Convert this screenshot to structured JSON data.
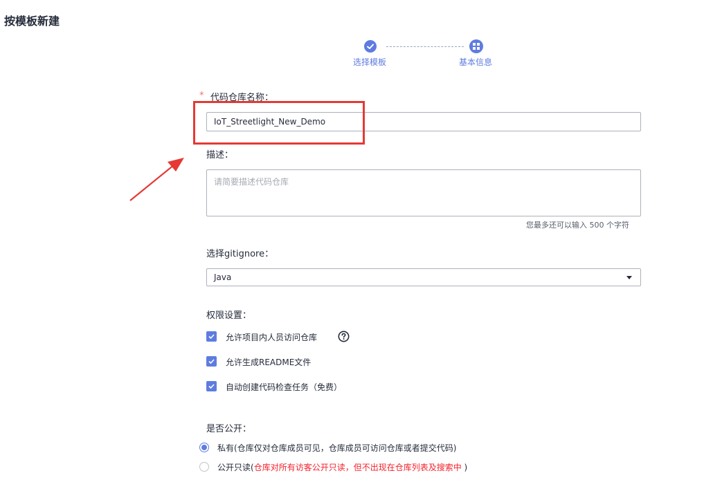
{
  "page": {
    "title": "按模板新建"
  },
  "stepper": {
    "steps": [
      {
        "label": "选择模板",
        "state": "done"
      },
      {
        "label": "基本信息",
        "state": "active"
      }
    ],
    "accent": "#5e7ce0"
  },
  "form": {
    "name": {
      "required_mark": "*",
      "label": "代码仓库名称：",
      "value": "IoT_Streetlight_New_Demo"
    },
    "description": {
      "label": "描述：",
      "placeholder": "请简要描述代码仓库",
      "counter_prefix": "您最多还可以输入",
      "counter_value": "500",
      "counter_suffix": "个字符"
    },
    "gitignore": {
      "label": "选择gitignore：",
      "value": "Java"
    },
    "permissions": {
      "label": "权限设置：",
      "items": [
        {
          "label": "允许项目内人员访问仓库",
          "checked": true
        },
        {
          "label": "允许生成README文件",
          "checked": true
        },
        {
          "label": "自动创建代码检查任务（免费）",
          "checked": true
        }
      ]
    },
    "visibility": {
      "label": "是否公开：",
      "options": [
        {
          "main": "私有",
          "detail": "(仓库仅对仓库成员可见，仓库成员可访问仓库或者提交代码)",
          "selected": true
        },
        {
          "main": "公开只读",
          "detail_open": "(",
          "detail_red": "仓库对所有访客公开只读，但不出现在仓库列表及搜索中",
          "detail_close": " )",
          "selected": false
        }
      ]
    }
  },
  "annotation": {
    "color": "#e53935"
  }
}
